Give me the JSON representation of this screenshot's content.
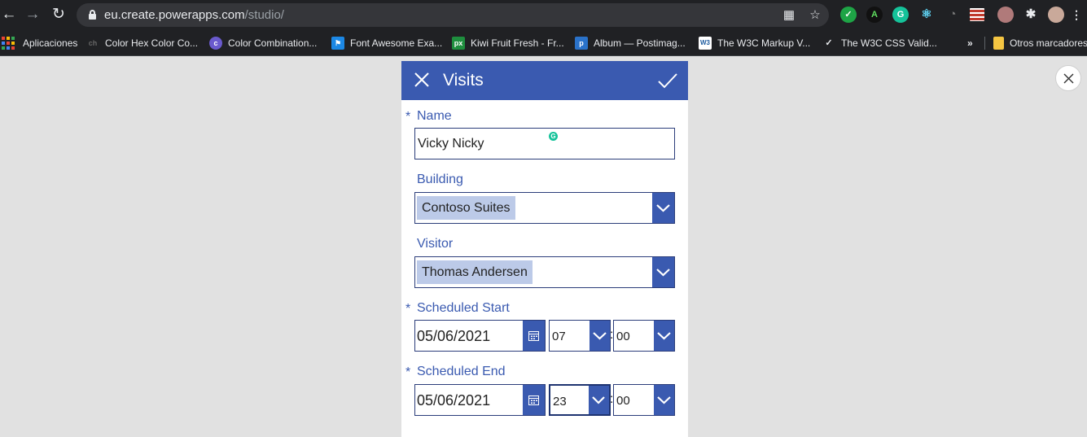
{
  "browser": {
    "url_host": "eu.create.powerapps.com",
    "url_path": "/studio/",
    "bookmarks": [
      {
        "label": "Aplicaciones",
        "icon": "apps-grid-icon"
      },
      {
        "label": "Color Hex Color Co...",
        "icon": "colorhex-icon"
      },
      {
        "label": "Color Combination...",
        "icon": "color-combination-icon"
      },
      {
        "label": "Font Awesome Exa...",
        "icon": "font-awesome-flag-icon"
      },
      {
        "label": "Kiwi Fruit Fresh - Fr...",
        "icon": "px-icon"
      },
      {
        "label": "Album — Postimag...",
        "icon": "postimage-icon"
      },
      {
        "label": "The W3C Markup V...",
        "icon": "w3c-icon"
      },
      {
        "label": "The W3C CSS Valid...",
        "icon": "w3c-css-icon"
      }
    ],
    "more_bookmarks": "»",
    "other_bookmarks": "Otros marcadores"
  },
  "form": {
    "title": "Visits",
    "required_mark": "*",
    "time_separator": ":",
    "name": {
      "label": "Name",
      "value": "Vicky Nicky"
    },
    "building": {
      "label": "Building",
      "value": "Contoso Suites"
    },
    "visitor": {
      "label": "Visitor",
      "value": "Thomas Andersen"
    },
    "scheduled_start": {
      "label": "Scheduled Start",
      "date": "05/06/2021",
      "hour": "07",
      "minute": "00"
    },
    "scheduled_end": {
      "label": "Scheduled End",
      "date": "05/06/2021",
      "hour": "23",
      "minute": "00"
    }
  },
  "colors": {
    "header": "#3a5ab0",
    "label": "#3a5ab0",
    "chip": "#bccae8",
    "canvas": "#e1e1e1"
  }
}
